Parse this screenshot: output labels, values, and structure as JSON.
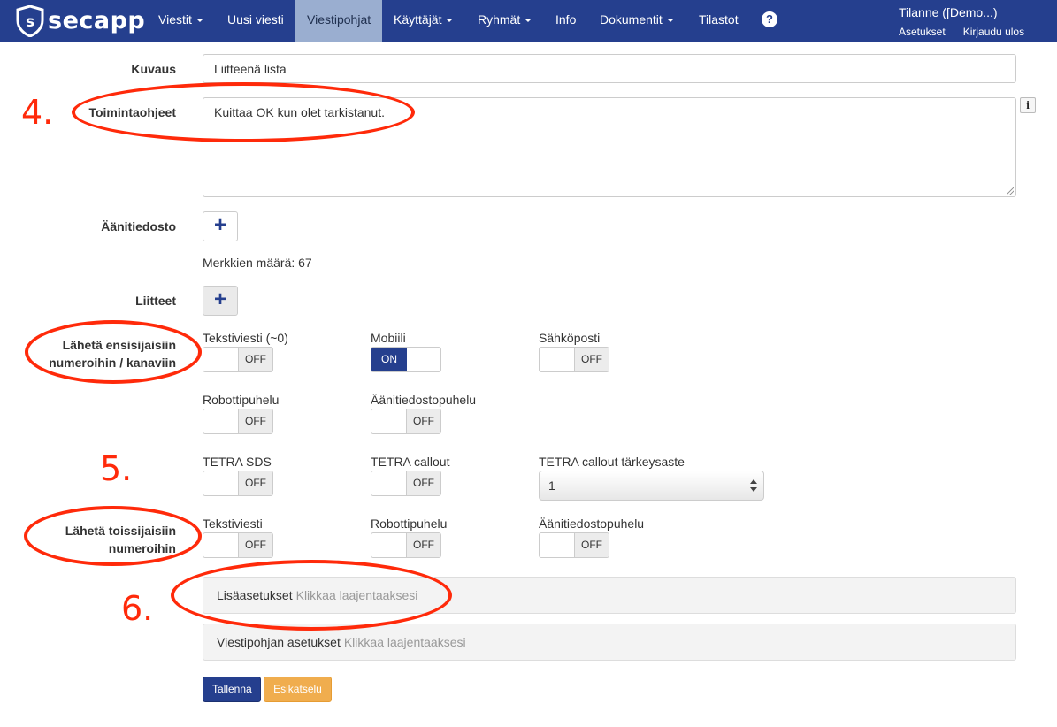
{
  "navbar": {
    "brand": "secapp",
    "items": [
      {
        "label": "Viestit",
        "dropdown": true
      },
      {
        "label": "Uusi viesti",
        "dropdown": false
      },
      {
        "label": "Viestipohjat",
        "dropdown": false,
        "active": true
      },
      {
        "label": "Käyttäjät",
        "dropdown": true
      },
      {
        "label": "Ryhmät",
        "dropdown": true
      },
      {
        "label": "Info",
        "dropdown": false
      },
      {
        "label": "Dokumentit",
        "dropdown": true
      },
      {
        "label": "Tilastot",
        "dropdown": false
      }
    ],
    "help_icon": "?",
    "user_name": "Tilanne ([Demo...)",
    "settings_link": "Asetukset",
    "logout_link": "Kirjaudu ulos"
  },
  "form": {
    "description": {
      "label": "Kuvaus",
      "value": "Liitteenä lista"
    },
    "instructions": {
      "label": "Toimintaohjeet",
      "value": "Kuittaa OK kun olet tarkistanut.",
      "info_icon": "i"
    },
    "audio_file": {
      "label": "Äänitiedosto",
      "add_icon": "+"
    },
    "char_count": "Merkkien määrä: 67",
    "attachments": {
      "label": "Liitteet",
      "add_icon": "+"
    },
    "primary": {
      "label_line1": "Lähetä ensisijaisiin",
      "label_line2": "numeroihin / kanaviin",
      "toggles": [
        {
          "label": "Tekstiviesti (~0)",
          "state": "OFF"
        },
        {
          "label": "Mobiili",
          "state": "ON"
        },
        {
          "label": "Sähköposti",
          "state": "OFF"
        },
        {
          "label": "Robottipuhelu",
          "state": "OFF"
        },
        {
          "label": "Äänitiedostopuhelu",
          "state": "OFF"
        },
        {
          "label": "TETRA SDS",
          "state": "OFF"
        },
        {
          "label": "TETRA callout",
          "state": "OFF"
        }
      ],
      "tetra_priority": {
        "label": "TETRA callout tärkeysaste",
        "value": "1"
      }
    },
    "secondary": {
      "label_line1": "Lähetä toissijaisiin",
      "label_line2": "numeroihin",
      "toggles": [
        {
          "label": "Tekstiviesti",
          "state": "OFF"
        },
        {
          "label": "Robottipuhelu",
          "state": "OFF"
        },
        {
          "label": "Äänitiedostopuhelu",
          "state": "OFF"
        }
      ]
    },
    "panels": [
      {
        "title": "Lisäasetukset",
        "hint": "Klikkaa laajentaaksesi"
      },
      {
        "title": "Viestipohjan asetukset",
        "hint": "Klikkaa laajentaaksesi"
      }
    ],
    "save_button": "Tallenna",
    "preview_button": "Esikatselu"
  },
  "annotations": {
    "n4": "4.",
    "n5": "5.",
    "n6": "6.",
    "color": "#ff2a0a"
  },
  "colors": {
    "navbar": "#253f8e",
    "active_tab": "#9aaed0",
    "preview_button": "#f0ad4e"
  }
}
